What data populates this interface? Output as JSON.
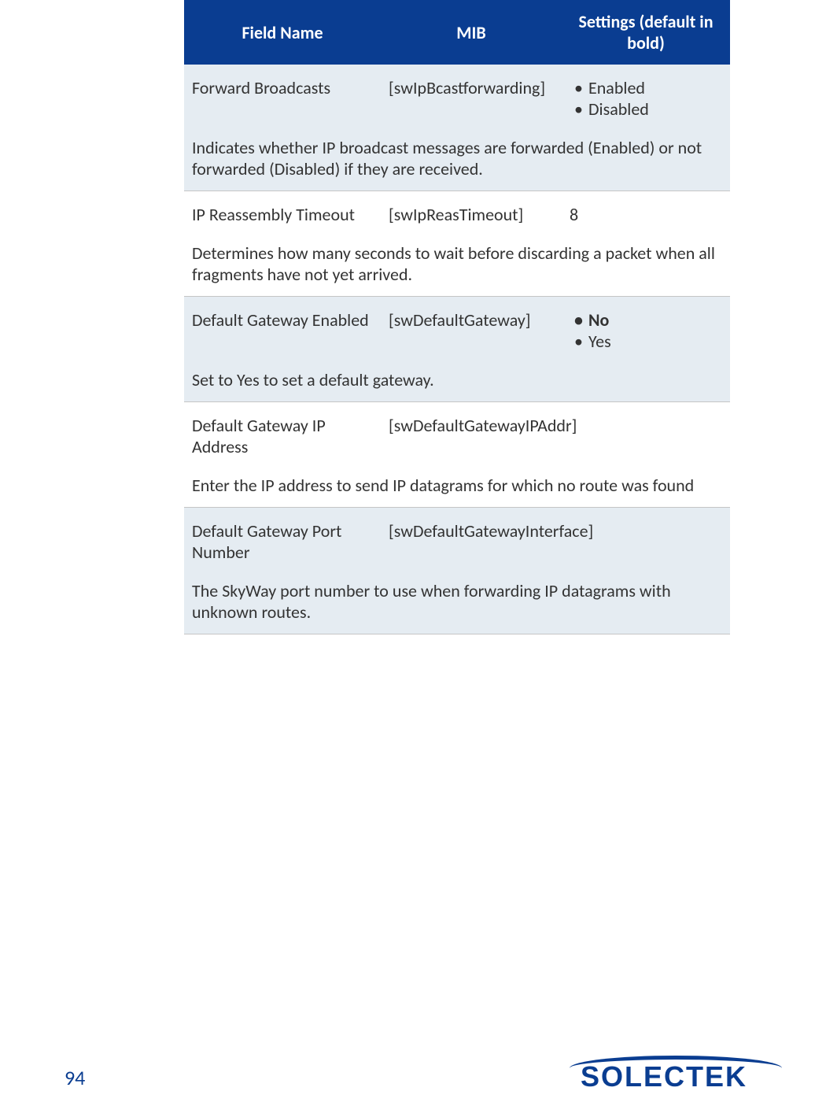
{
  "header": {
    "col1": "Field Name",
    "col2": "MIB",
    "col3": "Settings (default in bold)"
  },
  "rows": [
    {
      "fieldName": "Forward Broadcasts",
      "mib": "[swIpBcastforwarding]",
      "settings": [
        {
          "label": "Enabled",
          "default": false
        },
        {
          "label": "Disabled",
          "default": false
        }
      ],
      "desc": "Indicates whether IP broadcast messages are forwarded (Enabled) or not forwarded (Disabled) if they are received.",
      "shaded": true
    },
    {
      "fieldName": "IP Reassembly Timeout",
      "mib": "[swIpReasTimeout]",
      "settingsPlain": "8",
      "desc": "Determines how many seconds to wait before discarding a packet when all fragments have not yet arrived.",
      "shaded": false
    },
    {
      "fieldName": "Default Gateway Enabled",
      "mib": "[swDefaultGateway]",
      "settings": [
        {
          "label": "No",
          "default": true
        },
        {
          "label": "Yes",
          "default": false
        }
      ],
      "desc": "Set to Yes to set a default gateway.",
      "shaded": true
    },
    {
      "fieldName": "Default Gateway IP Address",
      "mib": "[swDefaultGatewayIPAddr]",
      "desc": "Enter the IP address to send IP datagrams for which no route was found",
      "shaded": false
    },
    {
      "fieldName": "Default Gateway Port Number",
      "mib": "[swDefaultGatewayInterface]",
      "desc": "The SkyWay port number to use when forwarding IP datagrams with unknown routes.",
      "shaded": true
    }
  ],
  "pageNumber": "94",
  "brand": "SOLECTEK"
}
